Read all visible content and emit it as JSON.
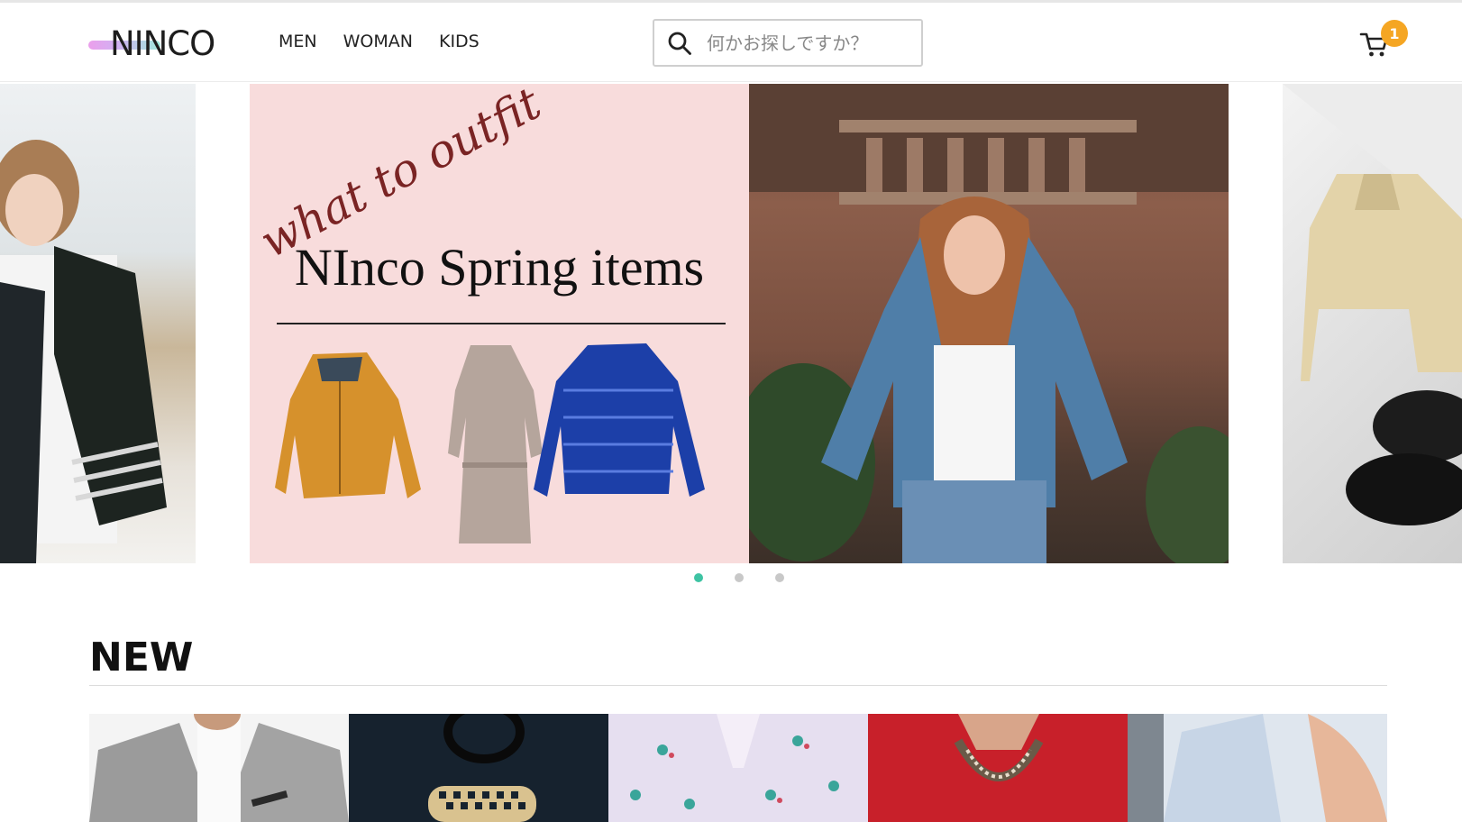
{
  "header": {
    "logo_text": "NINCO",
    "nav": [
      {
        "label": "MEN"
      },
      {
        "label": "WOMAN"
      },
      {
        "label": "KIDS"
      }
    ],
    "search": {
      "placeholder": "何かお探しですか？",
      "value": ""
    },
    "cart": {
      "icon": "cart-icon",
      "count": "1"
    }
  },
  "carousel": {
    "main_slide": {
      "script_text": "what to outfit",
      "title": "NInco Spring items"
    },
    "dots": [
      {
        "active": true
      },
      {
        "active": false
      },
      {
        "active": false
      }
    ]
  },
  "new_section": {
    "title": "NEW",
    "products": [
      {
        "icon": "grey-blazer-image"
      },
      {
        "icon": "black-tshirt-image"
      },
      {
        "icon": "floral-shirt-image"
      },
      {
        "icon": "red-blouse-image"
      },
      {
        "icon": "light-blue-shirt-image"
      }
    ]
  },
  "colors": {
    "accent_dot": "#3ec3a3",
    "badge": "#f5a623",
    "promo_background": "#f8dcdc"
  }
}
